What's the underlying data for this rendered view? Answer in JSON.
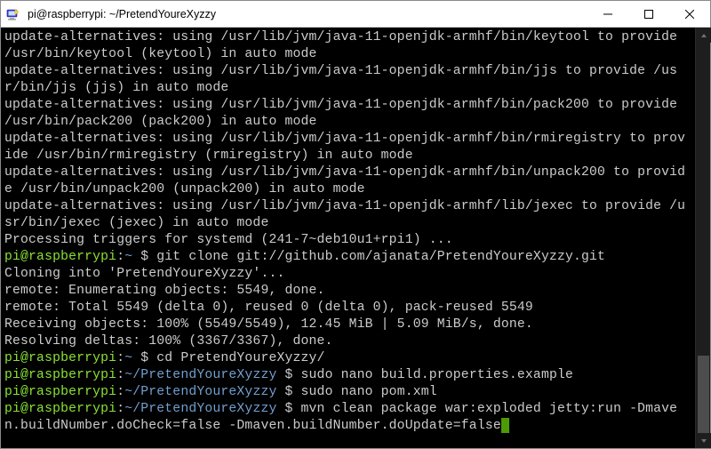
{
  "titlebar": {
    "title": "pi@raspberrypi: ~/PretendYoureXyzzy"
  },
  "lines": {
    "l0": "update-alternatives: using /usr/lib/jvm/java-11-openjdk-armhf/bin/keytool to provide /usr/bin/keytool (keytool) in auto mode",
    "l1": "update-alternatives: using /usr/lib/jvm/java-11-openjdk-armhf/bin/jjs to provide /usr/bin/jjs (jjs) in auto mode",
    "l2": "update-alternatives: using /usr/lib/jvm/java-11-openjdk-armhf/bin/pack200 to provide /usr/bin/pack200 (pack200) in auto mode",
    "l3": "update-alternatives: using /usr/lib/jvm/java-11-openjdk-armhf/bin/rmiregistry to provide /usr/bin/rmiregistry (rmiregistry) in auto mode",
    "l4": "update-alternatives: using /usr/lib/jvm/java-11-openjdk-armhf/bin/unpack200 to provide /usr/bin/unpack200 (unpack200) in auto mode",
    "l5": "update-alternatives: using /usr/lib/jvm/java-11-openjdk-armhf/lib/jexec to provide /usr/bin/jexec (jexec) in auto mode",
    "l6": "Processing triggers for systemd (241-7~deb10u1+rpi1) ..."
  },
  "prompt1": {
    "userhost": "pi@raspberrypi",
    "sep": ":",
    "path": "~",
    "dollar": " $ ",
    "cmd": "git clone git://github.com/ajanata/PretendYoureXyzzy.git"
  },
  "gitout": {
    "g0": "Cloning into 'PretendYoureXyzzy'...",
    "g1": "remote: Enumerating objects: 5549, done.",
    "g2": "remote: Total 5549 (delta 0), reused 0 (delta 0), pack-reused 5549",
    "g3": "Receiving objects: 100% (5549/5549), 12.45 MiB | 5.09 MiB/s, done.",
    "g4": "Resolving deltas: 100% (3367/3367), done."
  },
  "prompt2": {
    "userhost": "pi@raspberrypi",
    "sep": ":",
    "path": "~",
    "dollar": " $ ",
    "cmd": "cd PretendYoureXyzzy/"
  },
  "prompt3": {
    "userhost": "pi@raspberrypi",
    "sep": ":",
    "path": "~/PretendYoureXyzzy",
    "dollar": " $ ",
    "cmd": "sudo nano build.properties.example"
  },
  "prompt4": {
    "userhost": "pi@raspberrypi",
    "sep": ":",
    "path": "~/PretendYoureXyzzy",
    "dollar": " $ ",
    "cmd": "sudo nano pom.xml"
  },
  "prompt5": {
    "userhost": "pi@raspberrypi",
    "sep": ":",
    "path": "~/PretendYoureXyzzy",
    "dollar": " $ ",
    "cmd": "mvn clean package war:exploded jetty:run -Dmaven.buildNumber.doCheck=false -Dmaven.buildNumber.doUpdate=false"
  }
}
